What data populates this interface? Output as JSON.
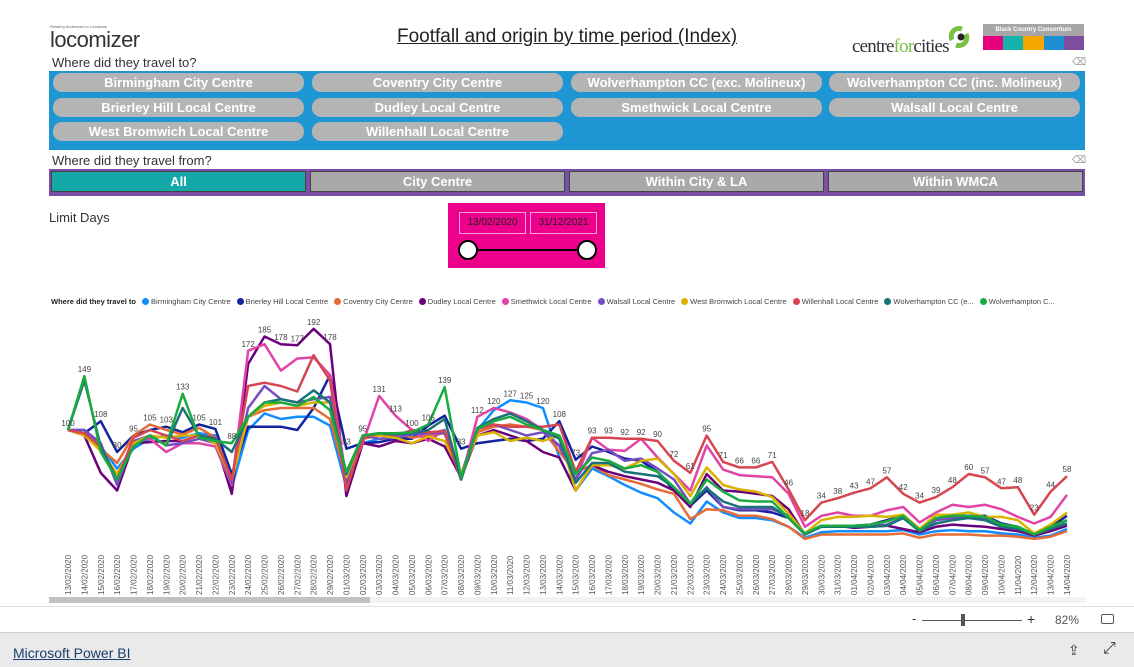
{
  "header": {
    "logo_tagline": "Relating Audiences to Locations",
    "logo_text": "locomizer",
    "title": "Footfall and origin by time period (Index)",
    "partner_logo": "centreforcities",
    "partner_logo2": "Black Country Consortium",
    "partner_logo2_colors": [
      "#e6007e",
      "#17b3ab",
      "#f5a700",
      "#1e8fd2",
      "#7e4e9e"
    ]
  },
  "travel_to": {
    "label": "Where did they travel to?",
    "panel_color": "#1e96d3",
    "options": [
      "Birmingham City Centre",
      "Coventry City Centre",
      "Wolverhampton CC (exc. Molineux)",
      "Wolverhampton CC (inc. Molineux)",
      "Brierley Hill Local Centre",
      "Dudley Local Centre",
      "Smethwick Local Centre",
      "Walsall Local Centre",
      "West Bromwich Local Centre",
      "Willenhall Local Centre"
    ]
  },
  "travel_from": {
    "label": "Where did they travel from?",
    "options": [
      "All",
      "City Centre",
      "Within City & LA",
      "Within WMCA"
    ],
    "selected": "All"
  },
  "limit_days": {
    "label": "Limit Days",
    "start": "13/02/2020",
    "end": "31/12/2021"
  },
  "chart_data": {
    "type": "line",
    "legend_title": "Where did they travel to",
    "legend_placement": "top-left",
    "grid": false,
    "ylim": [
      0,
      200
    ],
    "x": [
      "13/02/2020",
      "14/02/2020",
      "15/02/2020",
      "16/02/2020",
      "17/02/2020",
      "18/02/2020",
      "19/02/2020",
      "20/02/2020",
      "21/02/2020",
      "22/02/2020",
      "23/02/2020",
      "24/02/2020",
      "25/02/2020",
      "26/02/2020",
      "27/02/2020",
      "28/02/2020",
      "29/02/2020",
      "01/03/2020",
      "02/03/2020",
      "03/03/2020",
      "04/03/2020",
      "05/03/2020",
      "06/03/2020",
      "07/03/2020",
      "08/03/2020",
      "09/03/2020",
      "10/03/2020",
      "11/03/2020",
      "12/03/2020",
      "13/03/2020",
      "14/03/2020",
      "15/03/2020",
      "16/03/2020",
      "17/03/2020",
      "18/03/2020",
      "19/03/2020",
      "20/03/2020",
      "21/03/2020",
      "22/03/2020",
      "23/03/2020",
      "24/03/2020",
      "25/03/2020",
      "26/03/2020",
      "27/03/2020",
      "28/03/2020",
      "29/03/2020",
      "30/03/2020",
      "31/03/2020",
      "01/04/2020",
      "02/04/2020",
      "03/04/2020",
      "04/04/2020",
      "05/04/2020",
      "06/04/2020",
      "07/04/2020",
      "08/04/2020",
      "09/04/2020",
      "10/04/2020",
      "11/04/2020",
      "12/04/2020",
      "13/04/2020",
      "14/04/2020"
    ],
    "series": [
      {
        "name": "Birmingham City Centre",
        "legend_label": "Birmingham City Centre",
        "color": "#118dff",
        "values": [
          100,
          100,
          85,
          65,
          83,
          92,
          95,
          93,
          97,
          95,
          48,
          100,
          115,
          110,
          112,
          112,
          104,
          48,
          88,
          92,
          93,
          94,
          96,
          100,
          55,
          100,
          118,
          127,
          125,
          120,
          75,
          45,
          65,
          58,
          50,
          43,
          38,
          25,
          15,
          35,
          25,
          20,
          20,
          18,
          12,
          2,
          7,
          8,
          8,
          8,
          8,
          9,
          5,
          8,
          9,
          8,
          8,
          6,
          5,
          2,
          4,
          10
        ]
      },
      {
        "name": "Brierley Hill Local Centre",
        "legend_label": "Brierley Hill Local Centre",
        "color": "#12239e",
        "values": [
          100,
          97,
          108,
          80,
          95,
          100,
          103,
          98,
          105,
          101,
          60,
          103,
          103,
          103,
          100,
          120,
          150,
          83,
          88,
          89,
          92,
          92,
          104,
          113,
          83,
          88,
          90,
          92,
          90,
          92,
          108,
          73,
          85,
          80,
          74,
          72,
          62,
          45,
          31,
          45,
          30,
          27,
          27,
          25,
          20,
          6,
          13,
          13,
          13,
          14,
          18,
          22,
          9,
          18,
          22,
          22,
          22,
          15,
          12,
          5,
          12,
          22
        ]
      },
      {
        "name": "Coventry City Centre",
        "legend_label": "Coventry City Centre",
        "color": "#e66c37",
        "values": [
          100,
          97,
          83,
          70,
          95,
          105,
          100,
          96,
          102,
          93,
          55,
          112,
          118,
          120,
          120,
          120,
          110,
          55,
          92,
          95,
          97,
          93,
          95,
          97,
          55,
          98,
          103,
          105,
          103,
          100,
          80,
          62,
          68,
          59,
          55,
          51,
          46,
          42,
          19,
          28,
          27,
          22,
          22,
          19,
          12,
          1,
          5,
          5,
          5,
          5,
          5,
          6,
          2,
          5,
          5,
          5,
          4,
          4,
          3,
          1,
          3,
          8
        ]
      },
      {
        "name": "Dudley Local Centre",
        "legend_label": "Dudley Local Centre",
        "color": "#6b007b",
        "values": [
          100,
          95,
          61,
          45,
          88,
          89,
          90,
          90,
          95,
          90,
          42,
          160,
          185,
          178,
          177,
          192,
          178,
          40,
          88,
          85,
          90,
          88,
          92,
          85,
          57,
          95,
          100,
          95,
          90,
          80,
          75,
          45,
          68,
          62,
          58,
          55,
          52,
          45,
          30,
          60,
          45,
          44,
          42,
          40,
          28,
          5,
          13,
          13,
          11,
          12,
          13,
          10,
          7,
          12,
          14,
          13,
          12,
          10,
          8,
          4,
          8,
          13
        ]
      },
      {
        "name": "Smethwick Local Centre",
        "legend_label": "Smethwick Local Centre",
        "color": "#e044a7",
        "values": [
          100,
          95,
          85,
          55,
          90,
          92,
          80,
          88,
          88,
          85,
          50,
          172,
          178,
          154,
          165,
          166,
          150,
          55,
          88,
          131,
          113,
          100,
          90,
          100,
          55,
          112,
          120,
          116,
          110,
          100,
          85,
          55,
          93,
          82,
          81,
          92,
          75,
          60,
          45,
          86,
          64,
          59,
          58,
          57,
          42,
          12,
          22,
          25,
          22,
          22,
          27,
          30,
          16,
          25,
          32,
          30,
          32,
          28,
          21,
          15,
          21,
          41
        ]
      },
      {
        "name": "Walsall Local Centre",
        "legend_label": "Walsall Local Centre",
        "color": "#744ec2",
        "values": [
          100,
          100,
          88,
          50,
          90,
          95,
          86,
          88,
          92,
          88,
          52,
          120,
          140,
          128,
          125,
          128,
          130,
          52,
          95,
          92,
          93,
          96,
          97,
          97,
          60,
          101,
          105,
          100,
          95,
          98,
          86,
          55,
          79,
          82,
          72,
          74,
          65,
          55,
          33,
          48,
          30,
          28,
          28,
          28,
          22,
          5,
          12,
          12,
          12,
          13,
          14,
          20,
          8,
          18,
          20,
          20,
          20,
          12,
          10,
          5,
          10,
          18
        ]
      },
      {
        "name": "West Bromwich Local Centre",
        "legend_label": "West Bromwich Local Centre",
        "color": "#d9b300",
        "values": [
          100,
          95,
          81,
          60,
          88,
          95,
          93,
          95,
          95,
          88,
          55,
          112,
          122,
          125,
          122,
          125,
          125,
          57,
          95,
          95,
          93,
          88,
          94,
          90,
          60,
          95,
          98,
          90,
          93,
          90,
          95,
          45,
          68,
          68,
          65,
          72,
          74,
          60,
          40,
          66,
          50,
          46,
          44,
          39,
          24,
          6,
          18,
          21,
          21,
          22,
          21,
          23,
          10,
          23,
          23,
          25,
          21,
          21,
          18,
          6,
          14,
          25
        ]
      },
      {
        "name": "Willenhall Local Centre",
        "legend_label": "Willenhall Local Centre",
        "color": "#d64550",
        "values": [
          100,
          97,
          85,
          55,
          93,
          100,
          95,
          90,
          95,
          93,
          55,
          140,
          143,
          140,
          135,
          168,
          145,
          45,
          93,
          97,
          95,
          100,
          98,
          99,
          55,
          101,
          105,
          103,
          103,
          103,
          105,
          62,
          93,
          93,
          92,
          92,
          90,
          72,
          61,
          95,
          71,
          66,
          66,
          71,
          46,
          18,
          34,
          38,
          43,
          47,
          57,
          42,
          34,
          39,
          48,
          60,
          57,
          47,
          48,
          23,
          44,
          58
        ]
      },
      {
        "name": "Wolverhampton CC (exc. Molineux)",
        "legend_label": "Wolverhampton CC (e...",
        "color": "#197278",
        "values": [
          100,
          145,
          85,
          55,
          85,
          95,
          86,
          120,
          95,
          92,
          80,
          112,
          125,
          128,
          125,
          136,
          125,
          60,
          95,
          97,
          96,
          97,
          100,
          110,
          55,
          102,
          110,
          115,
          108,
          100,
          92,
          52,
          70,
          70,
          62,
          60,
          58,
          48,
          33,
          47,
          35,
          30,
          30,
          30,
          20,
          5,
          12,
          12,
          12,
          12,
          13,
          20,
          8,
          15,
          18,
          20,
          18,
          12,
          10,
          5,
          10,
          15
        ]
      },
      {
        "name": "Wolverhampton CC (inc. Molineux)",
        "legend_label": "Wolverhampton C...",
        "color": "#1aab40",
        "values": [
          100,
          149,
          80,
          55,
          85,
          95,
          86,
          133,
          93,
          90,
          88,
          112,
          125,
          125,
          122,
          130,
          118,
          62,
          95,
          97,
          97,
          98,
          105,
          139,
          57,
          101,
          108,
          112,
          105,
          100,
          95,
          60,
          75,
          72,
          65,
          68,
          62,
          48,
          33,
          55,
          44,
          36,
          35,
          35,
          20,
          6,
          13,
          13,
          13,
          14,
          17,
          22,
          9,
          20,
          22,
          22,
          21,
          14,
          12,
          5,
          12,
          18
        ]
      }
    ]
  },
  "toolbar": {
    "zoom_minus": "-",
    "zoom_plus": "+",
    "zoom_level": "82%",
    "zoom_fraction": 0.41
  },
  "footer": {
    "brand_link": "Microsoft Power BI"
  }
}
